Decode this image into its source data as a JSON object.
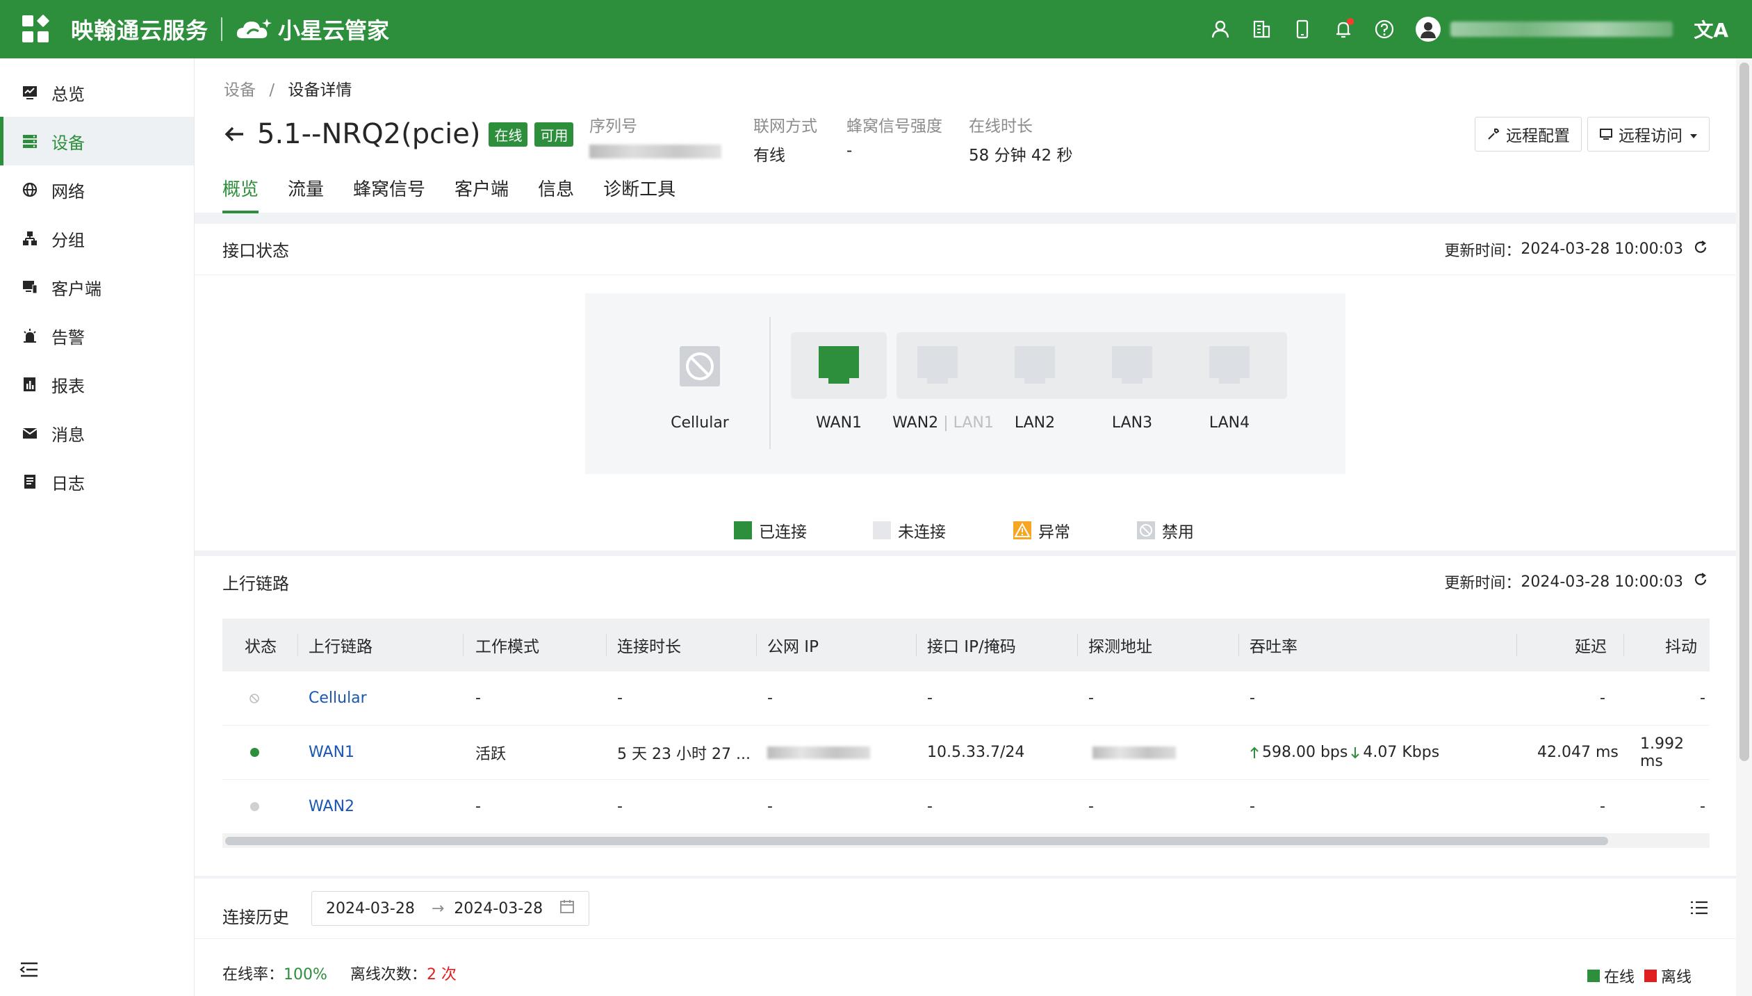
{
  "topbar": {
    "brand_primary": "映翰通云服务",
    "brand_secondary": "小星云管家",
    "lang_icon": "文A"
  },
  "sidebar": {
    "items": [
      {
        "label": "总览",
        "icon": "monitor-icon"
      },
      {
        "label": "设备",
        "icon": "server-icon"
      },
      {
        "label": "网络",
        "icon": "globe-icon"
      },
      {
        "label": "分组",
        "icon": "hierarchy-icon"
      },
      {
        "label": "客户端",
        "icon": "client-icon"
      },
      {
        "label": "告警",
        "icon": "alarm-icon"
      },
      {
        "label": "报表",
        "icon": "report-icon"
      },
      {
        "label": "消息",
        "icon": "mail-icon"
      },
      {
        "label": "日志",
        "icon": "log-icon"
      }
    ],
    "active_index": 1
  },
  "breadcrumb": {
    "root": "设备",
    "sep": "/",
    "current": "设备详情"
  },
  "device": {
    "name": "5.1--NRQ2(pcie)",
    "tag_online": "在线",
    "tag_available": "可用",
    "serial_label": "序列号",
    "conn_label": "联网方式",
    "conn_value": "有线",
    "signal_label": "蜂窝信号强度",
    "signal_value": "-",
    "uptime_label": "在线时长",
    "uptime_value": "58 分钟 42 秒"
  },
  "actions": {
    "remote_config": "远程配置",
    "remote_access": "远程访问"
  },
  "tabs": [
    "概览",
    "流量",
    "蜂窝信号",
    "客户端",
    "信息",
    "诊断工具"
  ],
  "interface_status": {
    "title": "接口状态",
    "update_label": "更新时间：",
    "update_time": "2024-03-28 10:00:03",
    "cellular_label": "Cellular",
    "ports": [
      {
        "label": "WAN1",
        "state": "connected"
      },
      {
        "label": "WAN2",
        "sub": "LAN1",
        "state": "disconnected"
      },
      {
        "label": "LAN2",
        "state": "disconnected"
      },
      {
        "label": "LAN3",
        "state": "disconnected"
      },
      {
        "label": "LAN4",
        "state": "disconnected"
      }
    ],
    "legend": [
      {
        "label": "已连接",
        "color": "#2d8f3c"
      },
      {
        "label": "未连接",
        "color": "#e5e7ea"
      },
      {
        "label": "异常",
        "color": "#f5a623"
      },
      {
        "label": "禁用",
        "color": "#cfd3d8"
      }
    ]
  },
  "uplink": {
    "title": "上行链路",
    "update_label": "更新时间：",
    "update_time": "2024-03-28 10:00:03",
    "columns": [
      "状态",
      "上行链路",
      "工作模式",
      "连接时长",
      "公网 IP",
      "接口 IP/掩码",
      "探测地址",
      "吞吐率",
      "延迟",
      "抖动"
    ],
    "rows": [
      {
        "status": "disabled",
        "link": "Cellular",
        "mode": "-",
        "duration": "-",
        "public_ip": "-",
        "iface_ip": "-",
        "probe": "-",
        "up": "-",
        "down": "",
        "latency": "-",
        "jitter": "-"
      },
      {
        "status": "online",
        "link": "WAN1",
        "mode": "活跃",
        "duration": "5 天 23 小时 27 ...",
        "public_ip": "",
        "iface_ip": "10.5.33.7/24",
        "probe": "",
        "up": "598.00 bps",
        "down": "4.07 Kbps",
        "latency": "42.047 ms",
        "jitter": "1.992 ms"
      },
      {
        "status": "offline",
        "link": "WAN2",
        "mode": "-",
        "duration": "-",
        "public_ip": "-",
        "iface_ip": "-",
        "probe": "-",
        "up": "-",
        "down": "",
        "latency": "-",
        "jitter": "-"
      }
    ]
  },
  "history": {
    "title": "连接历史",
    "date_start": "2024-03-28",
    "date_arrow": "→",
    "date_end": "2024-03-28",
    "online_rate_label": "在线率：",
    "online_rate": "100%",
    "offline_count_label": "离线次数：",
    "offline_count": "2 次",
    "legend_online": "在线",
    "legend_offline": "离线"
  },
  "colors": {
    "brand": "#2d8f3c",
    "link": "#1a56b3",
    "danger": "#e02020"
  }
}
